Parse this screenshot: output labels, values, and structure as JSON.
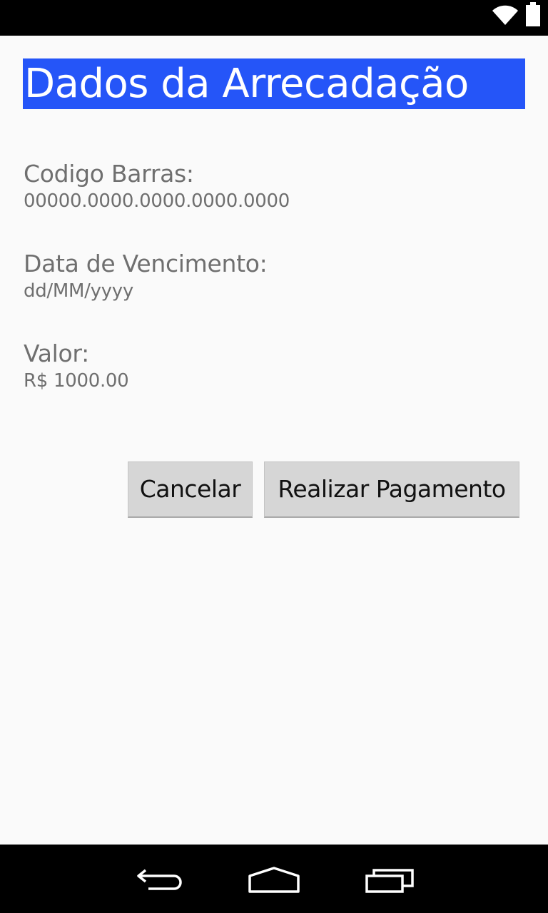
{
  "status_bar": {
    "icons": [
      "wifi-icon",
      "battery-icon"
    ]
  },
  "form": {
    "title": "Dados da Arrecadação",
    "title_bg_color": "#2555f8",
    "fields": [
      {
        "label": "Codigo Barras:",
        "value": "00000.0000.0000.0000.0000"
      },
      {
        "label": "Data de Vencimento:",
        "value": "dd/MM/yyyy"
      },
      {
        "label": "Valor:",
        "value": "R$ 1000.00"
      }
    ]
  },
  "actions": {
    "cancel_label": "Cancelar",
    "pay_label": "Realizar Pagamento"
  },
  "nav_bar": {
    "icons": [
      "back-icon",
      "home-icon",
      "recents-icon"
    ]
  }
}
